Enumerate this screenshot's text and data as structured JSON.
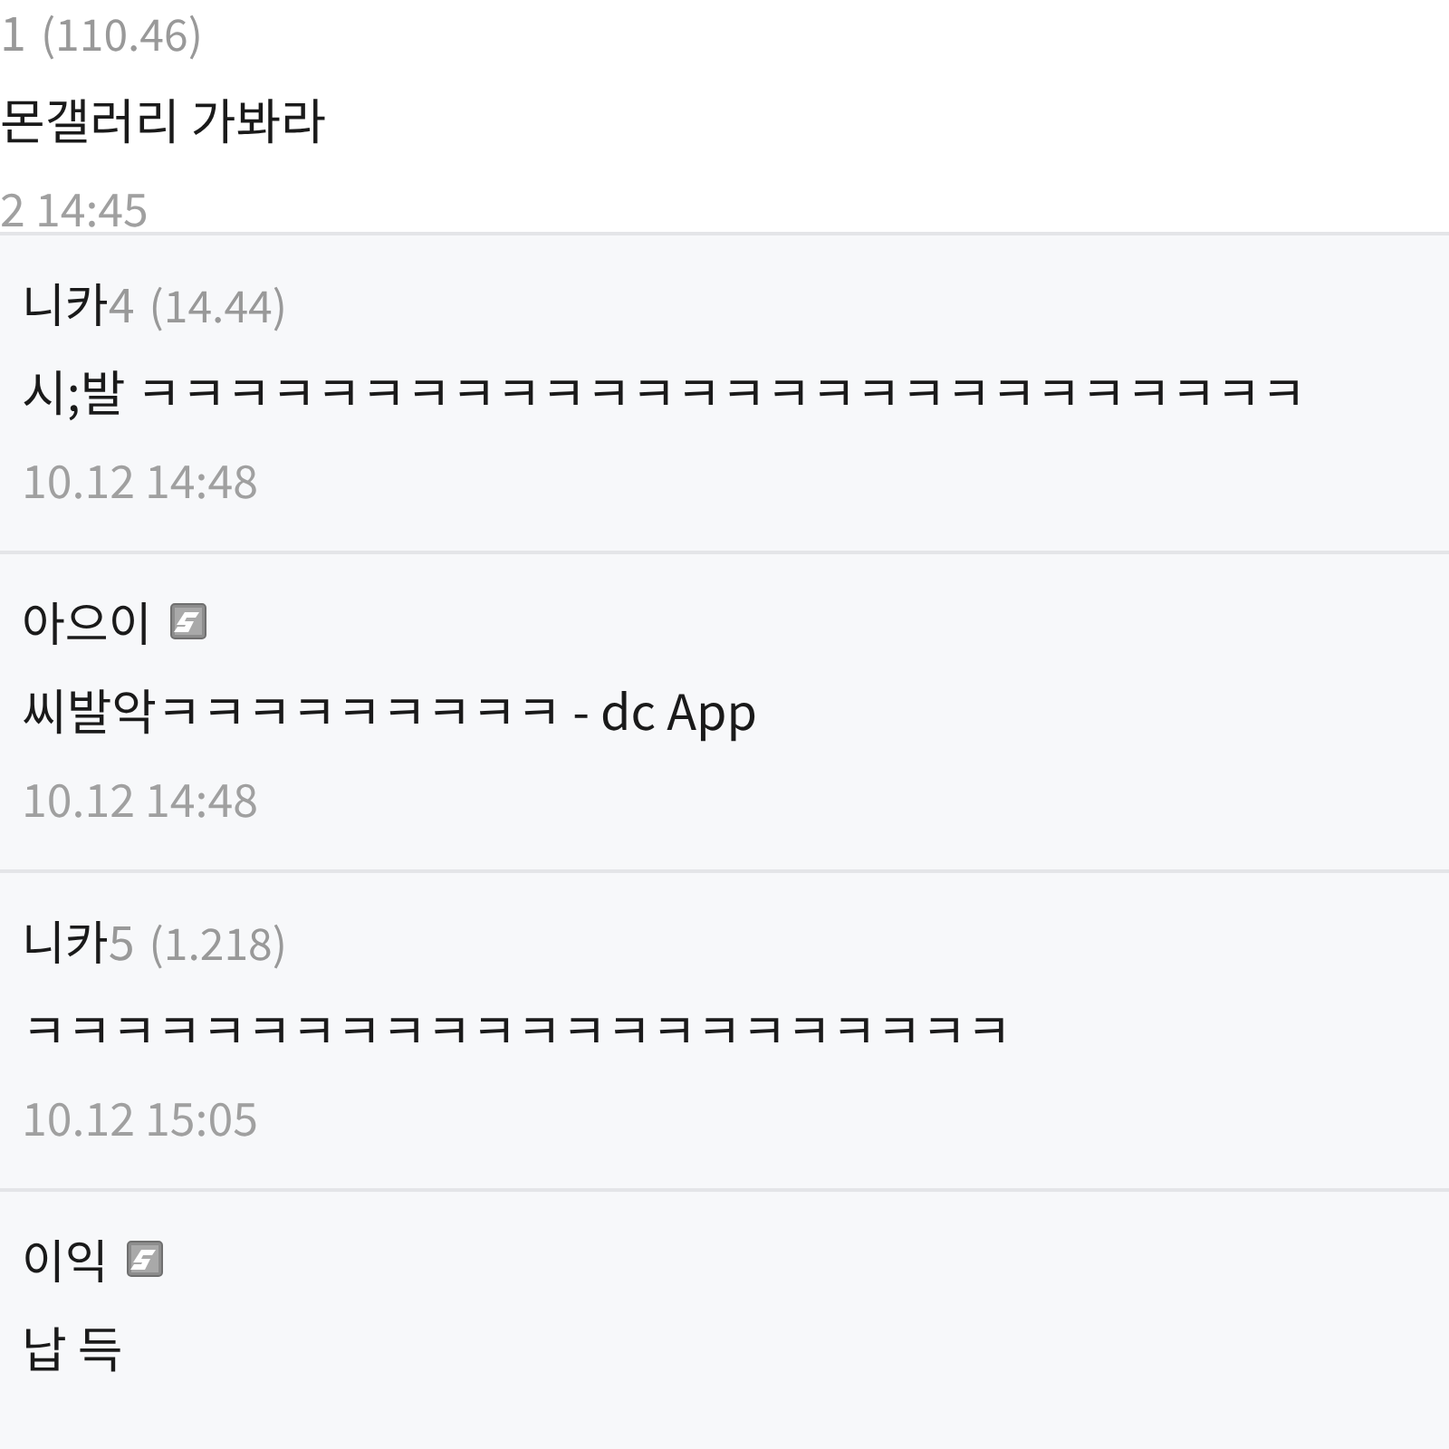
{
  "comments": [
    {
      "suffix": "1",
      "ip": "(110.46)",
      "content": "몬갤러리 가봐라",
      "date": "2 14:45",
      "children": [
        {
          "name": "니카",
          "suffix": "4",
          "ip": "(14.44)",
          "content": "시;발 ㅋㅋㅋㅋㅋㅋㅋㅋㅋㅋㅋㅋㅋㅋㅋㅋㅋㅋㅋㅋㅋㅋㅋㅋㅋㅋ",
          "date": "10.12 14:48"
        },
        {
          "kind": "member",
          "name": "아으이",
          "content": "씨발악ㅋㅋㅋㅋㅋㅋㅋㅋㅋ - dc App",
          "date": "10.12 14:48"
        },
        {
          "name": "니카",
          "suffix": "5",
          "ip": "(1.218)",
          "content": "ㅋㅋㅋㅋㅋㅋㅋㅋㅋㅋㅋㅋㅋㅋㅋㅋㅋㅋㅋㅋㅋㅋ",
          "date": "10.12 15:05"
        },
        {
          "kind": "member",
          "name": "이익",
          "content": "납 득"
        }
      ]
    }
  ]
}
